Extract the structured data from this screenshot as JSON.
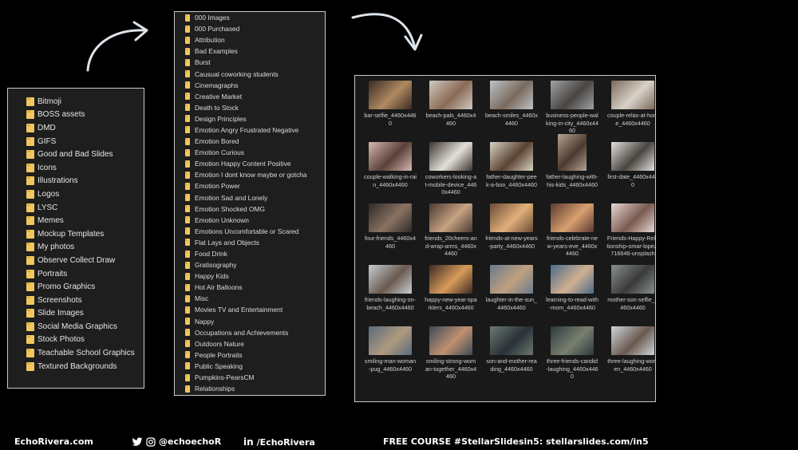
{
  "left_folders": [
    "Bitmoji",
    "BOSS assets",
    "DMD",
    "GIFS",
    "Good and Bad Slides",
    "Icons",
    "Illustrations",
    "Logos",
    "LYSC",
    "Memes",
    "Mockup Templates",
    "My photos",
    "Observe Collect Draw",
    "Portraits",
    "Promo Graphics",
    "Screenshots",
    "Slide Images",
    "Social Media Graphics",
    "Stock Photos",
    "Teachable School Graphics",
    "Textured Backgrounds"
  ],
  "mid_folders": [
    "000 Images",
    "000 Purchased",
    "Attribution",
    "Bad Examples",
    "Burst",
    "Causual coworking students",
    "Cinemagraphs",
    "Creative Market",
    "Death to Stock",
    "Design Principles",
    "Emotion Angry Frustrated Negative",
    "Emotion Bored",
    "Emotion Curious",
    "Emotion Happy Content Positive",
    "Emotion I dont know maybe or gotcha",
    "Emotion Power",
    "Emotion Sad and Lonely",
    "Emotion Shocked OMG",
    "Emotion Unknown",
    "Emotions Uncomfortable or Scared",
    "Flat Lays and Objects",
    "Food Drink",
    "Gratisography",
    "Happy Kids",
    "Hot Air Balloons",
    "Misc",
    "Movies TV and Entertainment",
    "Nappy",
    "Occupations and Achievements",
    "Outdoors Nature",
    "People Portraits",
    "Public Speaking",
    "Pumpkins-PearsCM",
    "Relationships"
  ],
  "thumbnails": [
    {
      "label": "bar-selfie_4460x4460",
      "c1": "#3a2b22",
      "c2": "#b08a62"
    },
    {
      "label": "beach-pals_4460x4460",
      "c1": "#cfc9bf",
      "c2": "#8a6a56"
    },
    {
      "label": "beach-smiles_4460x4460",
      "c1": "#bfc2c4",
      "c2": "#7a6a5e"
    },
    {
      "label": "business-people-walking-in-city_4460x4460",
      "c1": "#9ea3a6",
      "c2": "#4a4440"
    },
    {
      "label": "couple-relax-at-home_4460x4460",
      "c1": "#7d6a5a",
      "c2": "#d8d2c8"
    },
    {
      "label": "couple-walking-in-rain_4460x4460",
      "c1": "#d6b8b0",
      "c2": "#5a4038"
    },
    {
      "label": "coworkers-looking-at-mobile-device_4460x4460",
      "c1": "#3c3430",
      "c2": "#e4e0da"
    },
    {
      "label": "father-daughter-peek-a-boo_4460x4460",
      "c1": "#d8d2c6",
      "c2": "#5a4232"
    },
    {
      "label": "father-laughing-with-his-kids_4460x4460",
      "c1": "#b5a392",
      "c2": "#4a3a30",
      "tall": true
    },
    {
      "label": "first-date_4460x4460",
      "c1": "#e4e2de",
      "c2": "#4a4440"
    },
    {
      "label": "four-friends_4460x4460",
      "c1": "#2c2a28",
      "c2": "#8a7262"
    },
    {
      "label": "friends_20cheers-and-wrap-arms_4460x4460",
      "c1": "#4a3a32",
      "c2": "#c6a280"
    },
    {
      "label": "friends-at-new-years-party_4460x4460",
      "c1": "#6a4a36",
      "c2": "#e0b07a"
    },
    {
      "label": "friends-celebrate-new-years-eve_4460x4460",
      "c1": "#5a3a30",
      "c2": "#d8a070"
    },
    {
      "label": "Friends-Happy-Relationship-omar-lopez-716646-unsplash",
      "c1": "#e8d8d4",
      "c2": "#7a5a50"
    },
    {
      "label": "friends-laughing-on-beach_4460x4460",
      "c1": "#c8cdd2",
      "c2": "#6a5a50"
    },
    {
      "label": "happy-new-year-sparklers_4460x4460",
      "c1": "#3a2a22",
      "c2": "#d89a5a"
    },
    {
      "label": "laughter-in-the-sun_4460x4460",
      "c1": "#6a7a8a",
      "c2": "#c0a080"
    },
    {
      "label": "learning-to-read-with-mom_4460x4460",
      "c1": "#4a6a8a",
      "c2": "#d0b090"
    },
    {
      "label": "mother-son-selfie_4460x4460",
      "c1": "#8a9090",
      "c2": "#3a3a3a"
    },
    {
      "label": "smiling-man-woman-pug_4460x4460",
      "c1": "#5a6a7a",
      "c2": "#b09a80"
    },
    {
      "label": "smiling-strong-woman-together_4460x4460",
      "c1": "#3a4a5a",
      "c2": "#c09070"
    },
    {
      "label": "son-and-mother-reading_4460x4460",
      "c1": "#6a7a70",
      "c2": "#2a3038"
    },
    {
      "label": "three-friends-candid-laughing_4460x4460",
      "c1": "#2a3a3a",
      "c2": "#7a8070"
    },
    {
      "label": "three-laughing-women_4460x4460",
      "c1": "#d0d4d8",
      "c2": "#6a5a50"
    }
  ],
  "footer": {
    "brand": "EchoRivera.com",
    "twitter": "@echoechoR",
    "linkedin": "/EchoRivera",
    "course": "FREE COURSE #StellarSlidesin5: stellarslides.com/in5"
  },
  "colors": {
    "folder": "#f0c75e",
    "panel_bg": "#1e1e1e",
    "border": "#c8c8c8"
  }
}
